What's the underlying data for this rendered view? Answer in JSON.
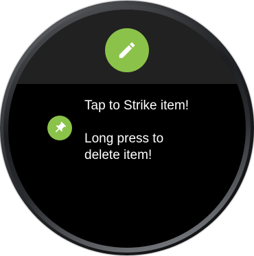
{
  "screen": {
    "action_icon": "pencil-icon",
    "badge_icon": "pushpin-icon",
    "accent_color": "#8bc34a",
    "header_color": "#212121",
    "background_color": "#000000"
  },
  "hints": {
    "tap_text": "Tap to Strike item!",
    "long_press_line1": "Long press to",
    "long_press_line2": "delete item!"
  }
}
